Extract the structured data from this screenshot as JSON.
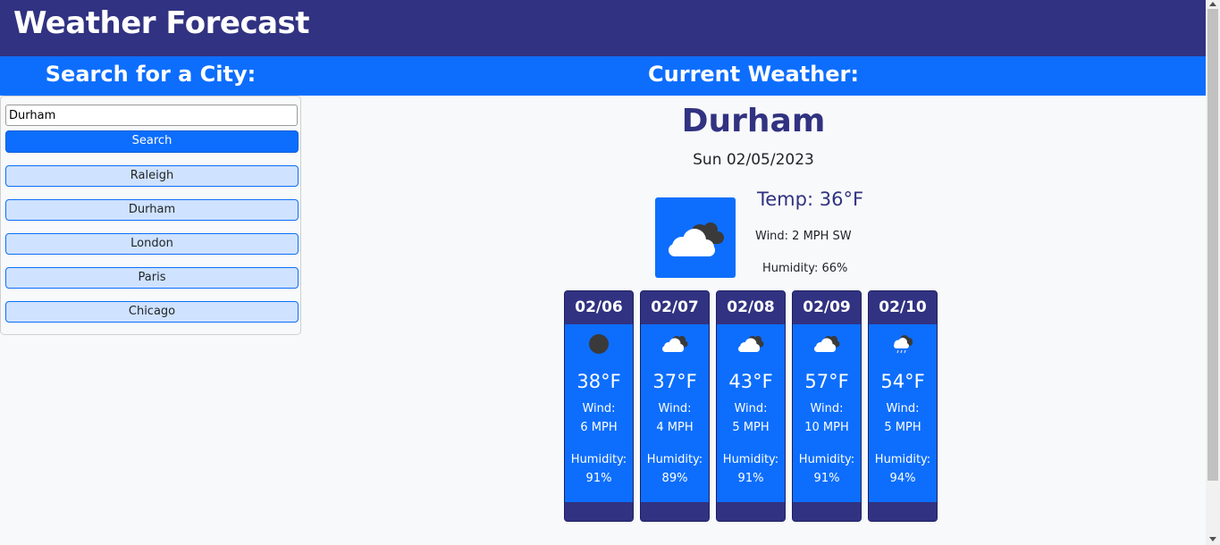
{
  "header": {
    "title": "Weather Forecast"
  },
  "subheader": {
    "left": "Search for a City:",
    "right": "Current Weather:"
  },
  "search": {
    "value": "Durham",
    "button_label": "Search"
  },
  "history": [
    "Raleigh",
    "Durham",
    "London",
    "Paris",
    "Chicago"
  ],
  "current": {
    "city": "Durham",
    "date": "Sun 02/05/2023",
    "icon": "cloud-with-dark-cloud-icon",
    "temp": "Temp: 36°F",
    "wind": "Wind: 2 MPH SW",
    "humidity": "Humidity: 66%"
  },
  "forecast": [
    {
      "date": "02/06",
      "icon": "dark-cloud-icon",
      "temp": "38°F",
      "wind_label": "Wind:",
      "wind": "6 MPH",
      "humidity_label": "Humidity:",
      "humidity": "91%"
    },
    {
      "date": "02/07",
      "icon": "cloud-with-dark-cloud-icon",
      "temp": "37°F",
      "wind_label": "Wind:",
      "wind": "4 MPH",
      "humidity_label": "Humidity:",
      "humidity": "89%"
    },
    {
      "date": "02/08",
      "icon": "cloud-with-dark-cloud-icon",
      "temp": "43°F",
      "wind_label": "Wind:",
      "wind": "5 MPH",
      "humidity_label": "Humidity:",
      "humidity": "91%"
    },
    {
      "date": "02/09",
      "icon": "cloud-with-dark-cloud-icon",
      "temp": "57°F",
      "wind_label": "Wind:",
      "wind": "10 MPH",
      "humidity_label": "Humidity:",
      "humidity": "91%"
    },
    {
      "date": "02/10",
      "icon": "rain-cloud-icon",
      "temp": "54°F",
      "wind_label": "Wind:",
      "wind": "5 MPH",
      "humidity_label": "Humidity:",
      "humidity": "94%"
    }
  ],
  "colors": {
    "navy": "#313281",
    "blue": "#0d6efd",
    "light_blue": "#cfe2ff",
    "background": "#f8f9fa"
  }
}
